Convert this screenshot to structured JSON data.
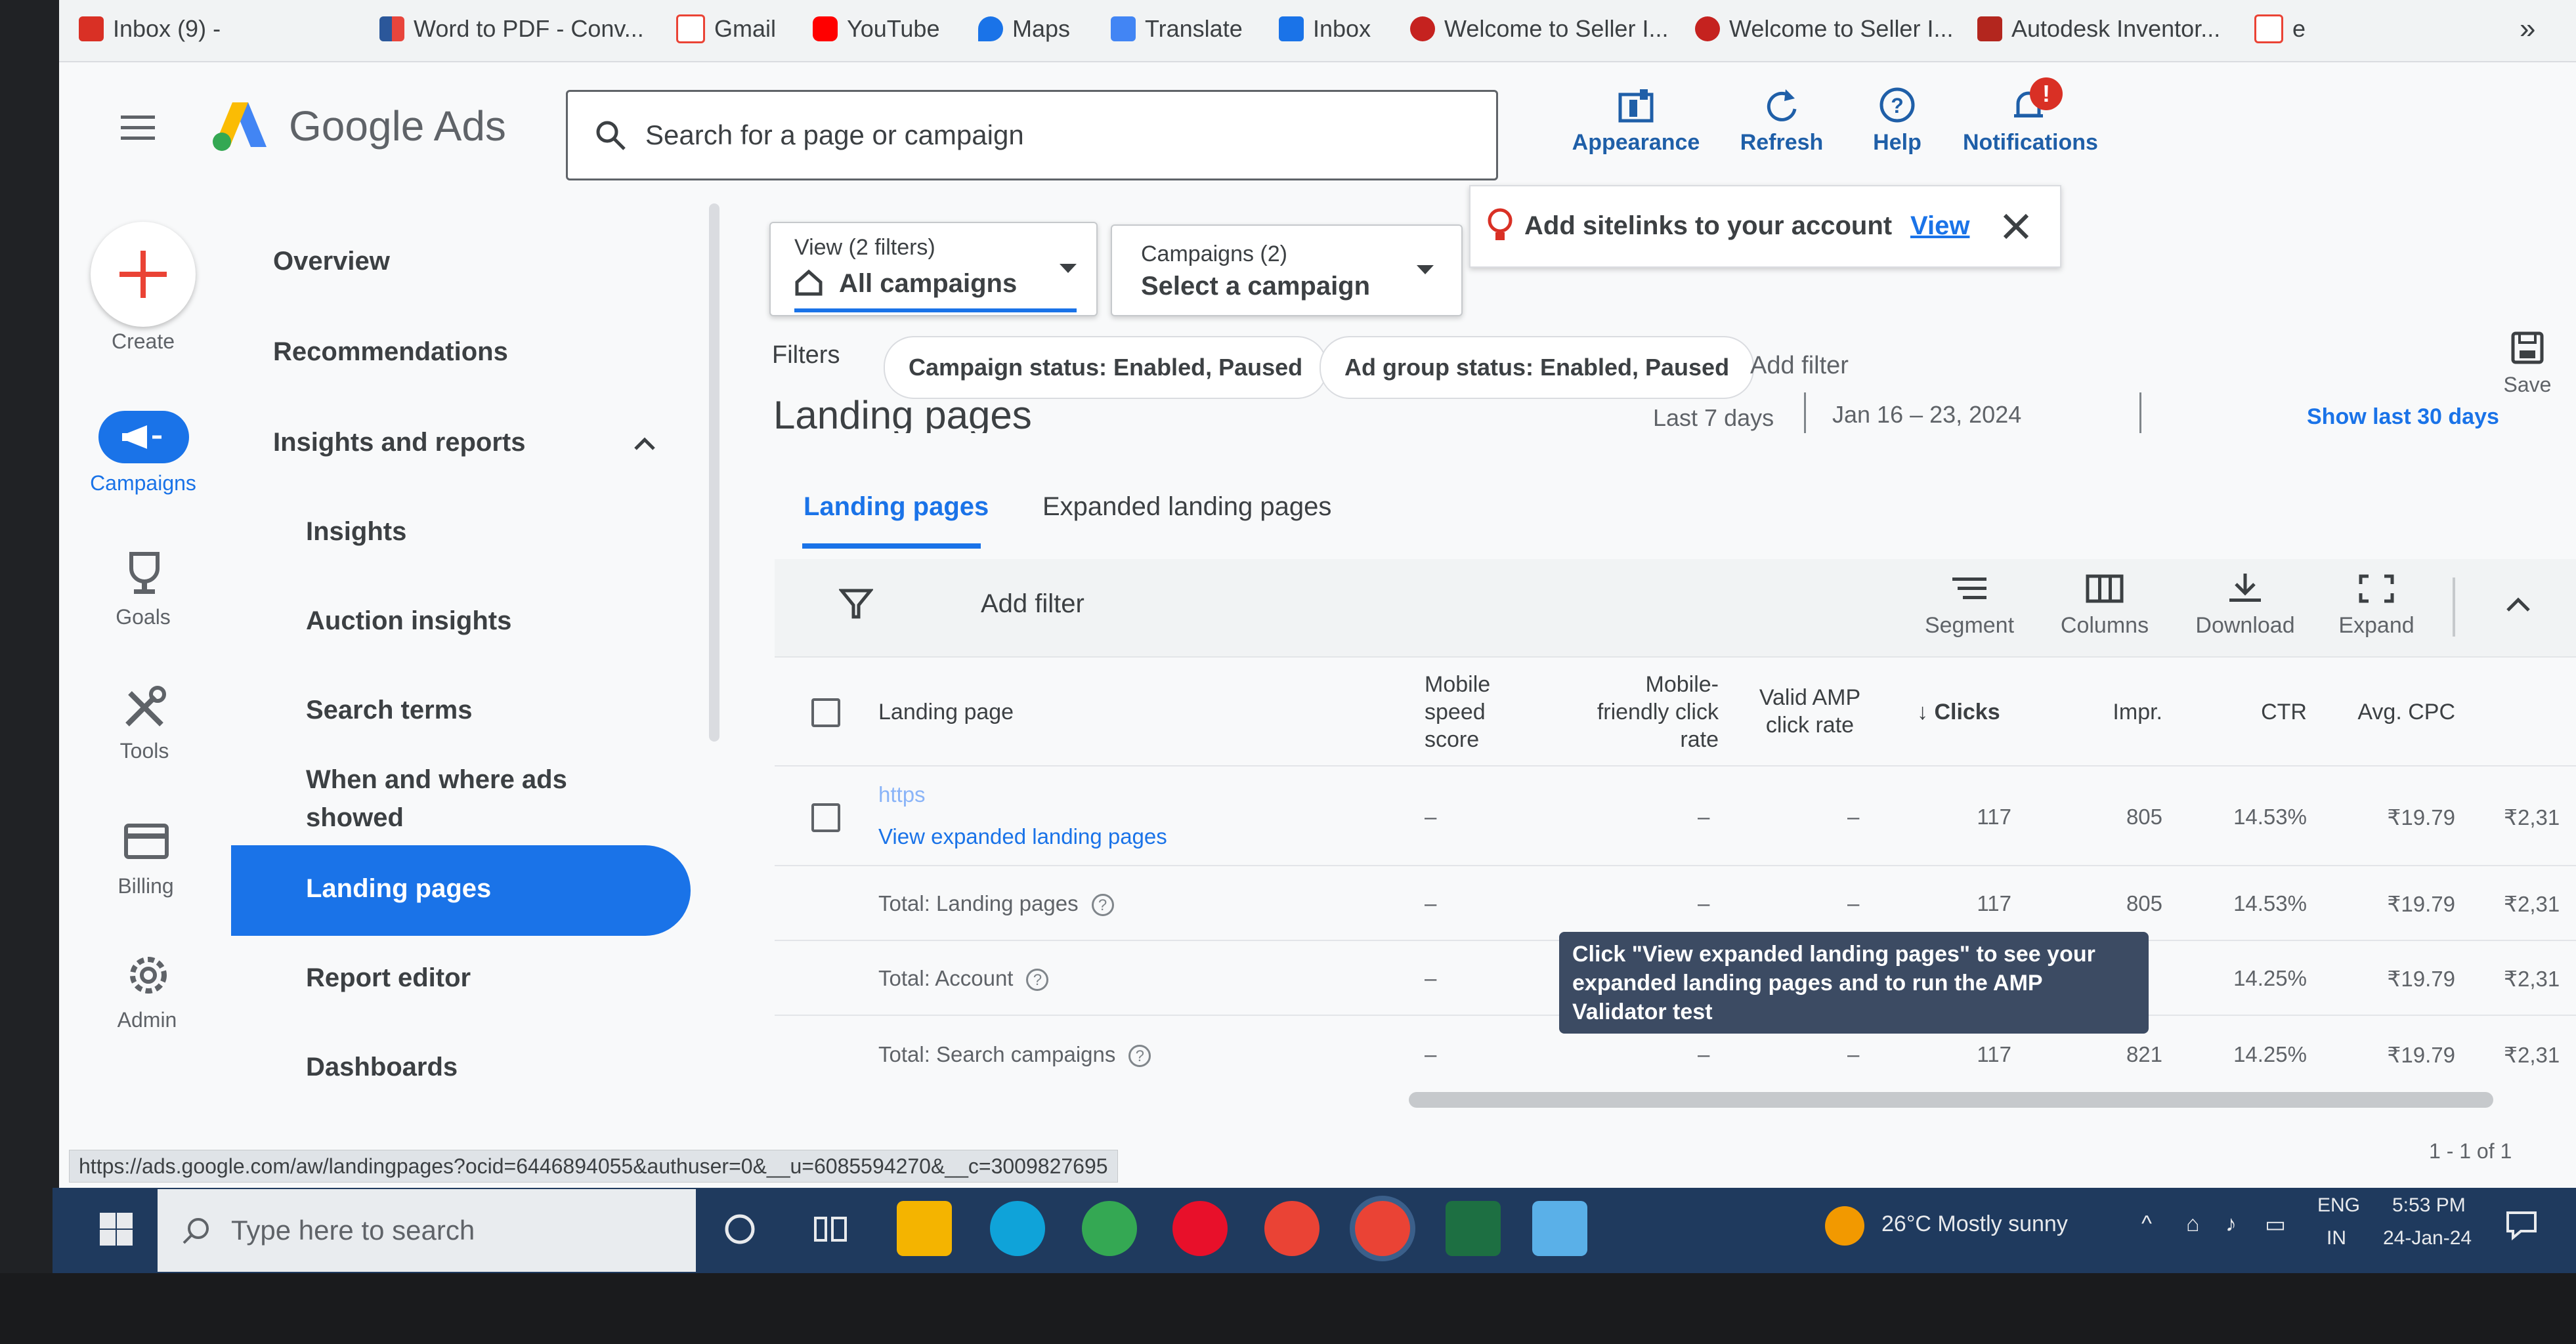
{
  "bookmarks": [
    {
      "label": "Inbox (9) -",
      "icon": "mail-icon",
      "color": "#c5221f"
    },
    {
      "label": "Word to PDF - Conv...",
      "icon": "word-pdf-icon",
      "color": "#e8453c"
    },
    {
      "label": "Gmail",
      "icon": "gmail-icon",
      "color": "#ea4335"
    },
    {
      "label": "YouTube",
      "icon": "youtube-icon",
      "color": "#ff0000"
    },
    {
      "label": "Maps",
      "icon": "maps-pin-icon",
      "color": "#1a73e8"
    },
    {
      "label": "Translate",
      "icon": "translate-icon",
      "color": "#4285f4"
    },
    {
      "label": "Inbox",
      "icon": "hub-inbox-icon",
      "color": "#1a73e8"
    },
    {
      "label": "Welcome to Seller I...",
      "icon": "seller-icon",
      "color": "#c5221f"
    },
    {
      "label": "Welcome to Seller I...",
      "icon": "seller-icon",
      "color": "#c5221f"
    },
    {
      "label": "Autodesk Inventor...",
      "icon": "autodesk-icon",
      "color": "#b3261e"
    },
    {
      "label": "e",
      "icon": "gmail-icon",
      "color": "#ea4335"
    }
  ],
  "bookmarks_more": "»",
  "header": {
    "product": "Google Ads",
    "search_placeholder": "Search for a page or campaign",
    "actions": [
      {
        "label": "Appearance",
        "icon": "appearance-icon"
      },
      {
        "label": "Refresh",
        "icon": "refresh-icon"
      },
      {
        "label": "Help",
        "icon": "help-icon"
      },
      {
        "label": "Notifications",
        "icon": "bell-icon",
        "badge": "!"
      }
    ]
  },
  "rail": [
    {
      "label": "Create",
      "icon": "plus-icon"
    },
    {
      "label": "Campaigns",
      "icon": "campaigns-icon"
    },
    {
      "label": "Goals",
      "icon": "trophy-icon"
    },
    {
      "label": "Tools",
      "icon": "tools-icon"
    },
    {
      "label": "Billing",
      "icon": "card-icon"
    },
    {
      "label": "Admin",
      "icon": "gear-icon"
    }
  ],
  "nav": {
    "overview": "Overview",
    "recommendations": "Recommendations",
    "insights_reports": "Insights and reports",
    "insights": "Insights",
    "auction": "Auction insights",
    "search_terms": "Search terms",
    "when_where_1": "When and where ads",
    "when_where_2": "showed",
    "landing_pages": "Landing pages",
    "report_editor": "Report editor",
    "dashboards": "Dashboards"
  },
  "filters": {
    "view_label": "View (2 filters)",
    "view_value": "All campaigns",
    "campaigns_label": "Campaigns (2)",
    "campaigns_value": "Select a campaign",
    "filters_label": "Filters",
    "chips": [
      "Campaign status: Enabled, Paused",
      "Ad group status: Enabled, Paused"
    ],
    "add_filter": "Add filter",
    "save": "Save"
  },
  "banner": {
    "text": "Add sitelinks to your account",
    "link": "View"
  },
  "page": {
    "title": "Landing pages",
    "date_range_label": "Last 7 days",
    "date_value": "Jan 16 – 23, 2024",
    "show_last": "Show last 30 days"
  },
  "tabs": [
    "Landing pages",
    "Expanded landing pages"
  ],
  "toolbar": {
    "add_filter": "Add filter",
    "actions": [
      {
        "label": "Segment",
        "icon": "segment-icon"
      },
      {
        "label": "Columns",
        "icon": "columns-icon"
      },
      {
        "label": "Download",
        "icon": "download-icon"
      },
      {
        "label": "Expand",
        "icon": "expand-icon"
      }
    ]
  },
  "table": {
    "headers": {
      "landing_page": "Landing page",
      "mobile_speed": [
        "Mobile",
        "speed",
        "score"
      ],
      "mobile_friendly": [
        "Mobile-",
        "friendly click",
        "rate"
      ],
      "valid_amp": [
        "Valid AMP",
        "click rate"
      ],
      "clicks": "Clicks",
      "impr": "Impr.",
      "ctr": "CTR",
      "avg_cpc": "Avg. CPC"
    },
    "rows": [
      {
        "label": "https",
        "sub": "View expanded landing pages",
        "speed": "–",
        "friendly": "–",
        "amp": "–",
        "clicks": "117",
        "impr": "805",
        "ctr": "14.53%",
        "cpc": "₹19.79",
        "cost": "₹2,31"
      },
      {
        "label": "Total: Landing pages",
        "speed": "–",
        "friendly": "–",
        "amp": "–",
        "clicks": "117",
        "impr": "805",
        "ctr": "14.53%",
        "cpc": "₹19.79",
        "cost": "₹2,31"
      },
      {
        "label": "Total: Account",
        "speed": "–",
        "friendly": "",
        "amp": "",
        "clicks": "",
        "impr": "",
        "ctr": "14.25%",
        "cpc": "₹19.79",
        "cost": "₹2,31"
      },
      {
        "label": "Total: Search campaigns",
        "speed": "–",
        "friendly": "–",
        "amp": "–",
        "clicks": "117",
        "impr": "821",
        "ctr": "14.25%",
        "cpc": "₹19.79",
        "cost": "₹2,31"
      }
    ],
    "pagination": "1 - 1 of 1"
  },
  "tooltip": "Click \"View expanded landing pages\" to see your expanded landing pages and to run the AMP Validator test",
  "status_url": "https://ads.google.com/aw/landingpages?ocid=6446894055&authuser=0&__u=6085594270&__c=3009827695",
  "taskbar": {
    "search_placeholder": "Type here to search",
    "weather": "26°C  Mostly sunny",
    "lang_1": "ENG",
    "lang_2": "IN",
    "time": "5:53 PM",
    "date": "24-Jan-24"
  },
  "colors": {
    "accent": "#1a73e8",
    "nav_active": "#1a73e8",
    "taskbar": "#1f3a5e",
    "tooltip": "#3c4b63"
  }
}
